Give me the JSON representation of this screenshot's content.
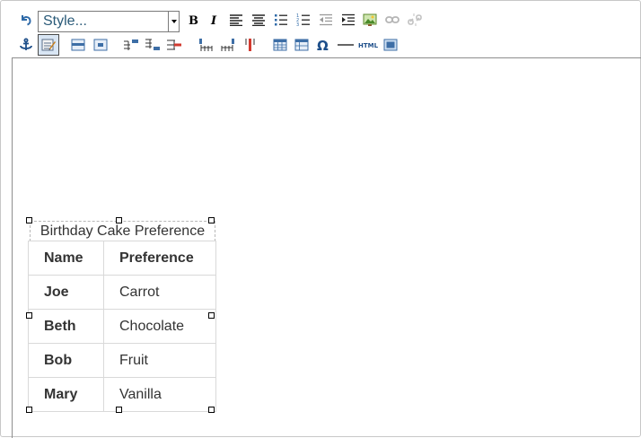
{
  "toolbar": {
    "style_select_value": "Style...",
    "row1": [
      {
        "name": "undo-icon"
      },
      {
        "name": "bold-icon"
      },
      {
        "name": "italic-icon"
      },
      {
        "name": "align-left-icon"
      },
      {
        "name": "align-center-icon"
      },
      {
        "name": "bulleted-list-icon"
      },
      {
        "name": "numbered-list-icon"
      },
      {
        "name": "outdent-icon"
      },
      {
        "name": "indent-icon"
      },
      {
        "name": "insert-image-icon"
      },
      {
        "name": "insert-link-icon"
      },
      {
        "name": "remove-link-icon"
      }
    ],
    "row2": [
      {
        "name": "anchor-icon"
      },
      {
        "name": "table-properties-icon",
        "active": true
      },
      {
        "name": "row-properties-icon"
      },
      {
        "name": "cell-properties-icon"
      },
      {
        "name": "insert-row-before-icon"
      },
      {
        "name": "insert-row-after-icon"
      },
      {
        "name": "delete-row-icon"
      },
      {
        "name": "insert-column-before-icon"
      },
      {
        "name": "insert-column-after-icon"
      },
      {
        "name": "delete-column-icon"
      },
      {
        "name": "insert-table-icon"
      },
      {
        "name": "table-grid-icon"
      },
      {
        "name": "special-character-icon",
        "glyph": "Ω"
      },
      {
        "name": "horizontal-rule-icon"
      },
      {
        "name": "html-source-icon",
        "text": "HTML"
      },
      {
        "name": "fullscreen-icon"
      }
    ]
  },
  "table": {
    "caption": "Birthday Cake Preference",
    "headers": [
      "Name",
      "Preference"
    ],
    "rows": [
      [
        "Joe",
        "Carrot"
      ],
      [
        "Beth",
        "Chocolate"
      ],
      [
        "Bob",
        "Fruit"
      ],
      [
        "Mary",
        "Vanilla"
      ]
    ]
  }
}
